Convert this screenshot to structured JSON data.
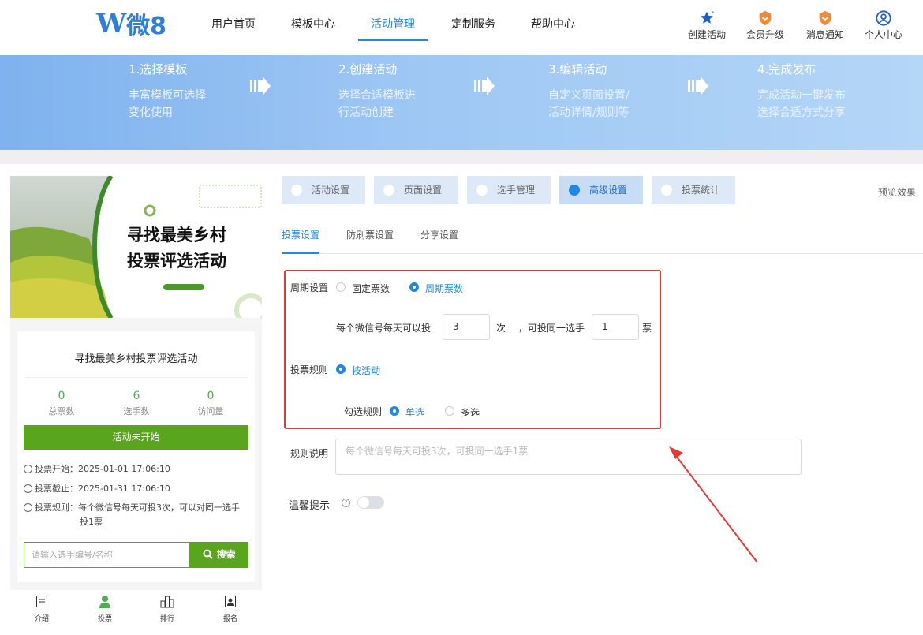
{
  "header": {
    "logo_mark": "W",
    "logo_text": "微8",
    "nav": [
      "用户首页",
      "模板中心",
      "活动管理",
      "定制服务",
      "帮助中心"
    ],
    "actions": [
      {
        "label": "创建活动",
        "icon": "star-icon"
      },
      {
        "label": "会员升级",
        "icon": "badge-icon"
      },
      {
        "label": "消息通知",
        "icon": "bell-badge-icon"
      },
      {
        "label": "个人中心",
        "icon": "user-circle-icon"
      }
    ]
  },
  "banner": {
    "steps": [
      {
        "title": "1.选择模板",
        "line1": "丰富模板可选择",
        "line2": "变化使用"
      },
      {
        "title": "2.创建活动",
        "line1": "选择合适模板进",
        "line2": "行活动创建"
      },
      {
        "title": "3.编辑活动",
        "line1": "自定义页面设置/",
        "line2": "活动详情/规则等"
      },
      {
        "title": "4.完成发布",
        "line1": "完成活动一键发布",
        "line2": "选择合适方式分享"
      }
    ]
  },
  "preview": {
    "poster_line1": "寻找最美乡村",
    "poster_line2": "投票评选活动",
    "title": "寻找最美乡村投票评选活动",
    "stats": [
      {
        "value": "0",
        "label": "总票数"
      },
      {
        "value": "6",
        "label": "选手数"
      },
      {
        "value": "0",
        "label": "访问量"
      }
    ],
    "status_button": "活动未开始",
    "start": "投票开始：2025-01-01 17:06:10",
    "end": "投票截止：2025-01-31 17:06:10",
    "rule_line1": "投票规则：每个微信号每天可投3次，可以对同一选手",
    "rule_line2": "投1票",
    "search_placeholder": "请输入选手编号/名称",
    "search_button": "搜索",
    "bottom_nav": [
      "介绍",
      "投票",
      "排行",
      "报名"
    ]
  },
  "settings": {
    "tabs": [
      "活动设置",
      "页面设置",
      "选手管理",
      "高级设置",
      "投票统计"
    ],
    "preview_link": "预览效果",
    "subtabs": [
      "投票设置",
      "防刷票设置",
      "分享设置"
    ],
    "period_label": "周期设置",
    "period_fixed": "固定票数",
    "period_cycle": "周期票数",
    "daily_prefix": "每个微信号每天可以投",
    "daily_value": "3",
    "daily_unit": "次",
    "same_prefix": "，可投同一选手",
    "same_value": "1",
    "same_unit": "票",
    "rule_label": "投票规则",
    "rule_option": "按活动",
    "check_label": "勾选规则",
    "single": "单选",
    "multi": "多选",
    "desc_label": "规则说明",
    "desc_placeholder": "每个微信号每天可投3次，可投同一选手1票",
    "tip_label": "温馨提示",
    "tip_on": false
  },
  "colors": {
    "accent": "#1e88e5",
    "green": "#5aa51e",
    "highlight": "#e53935"
  }
}
